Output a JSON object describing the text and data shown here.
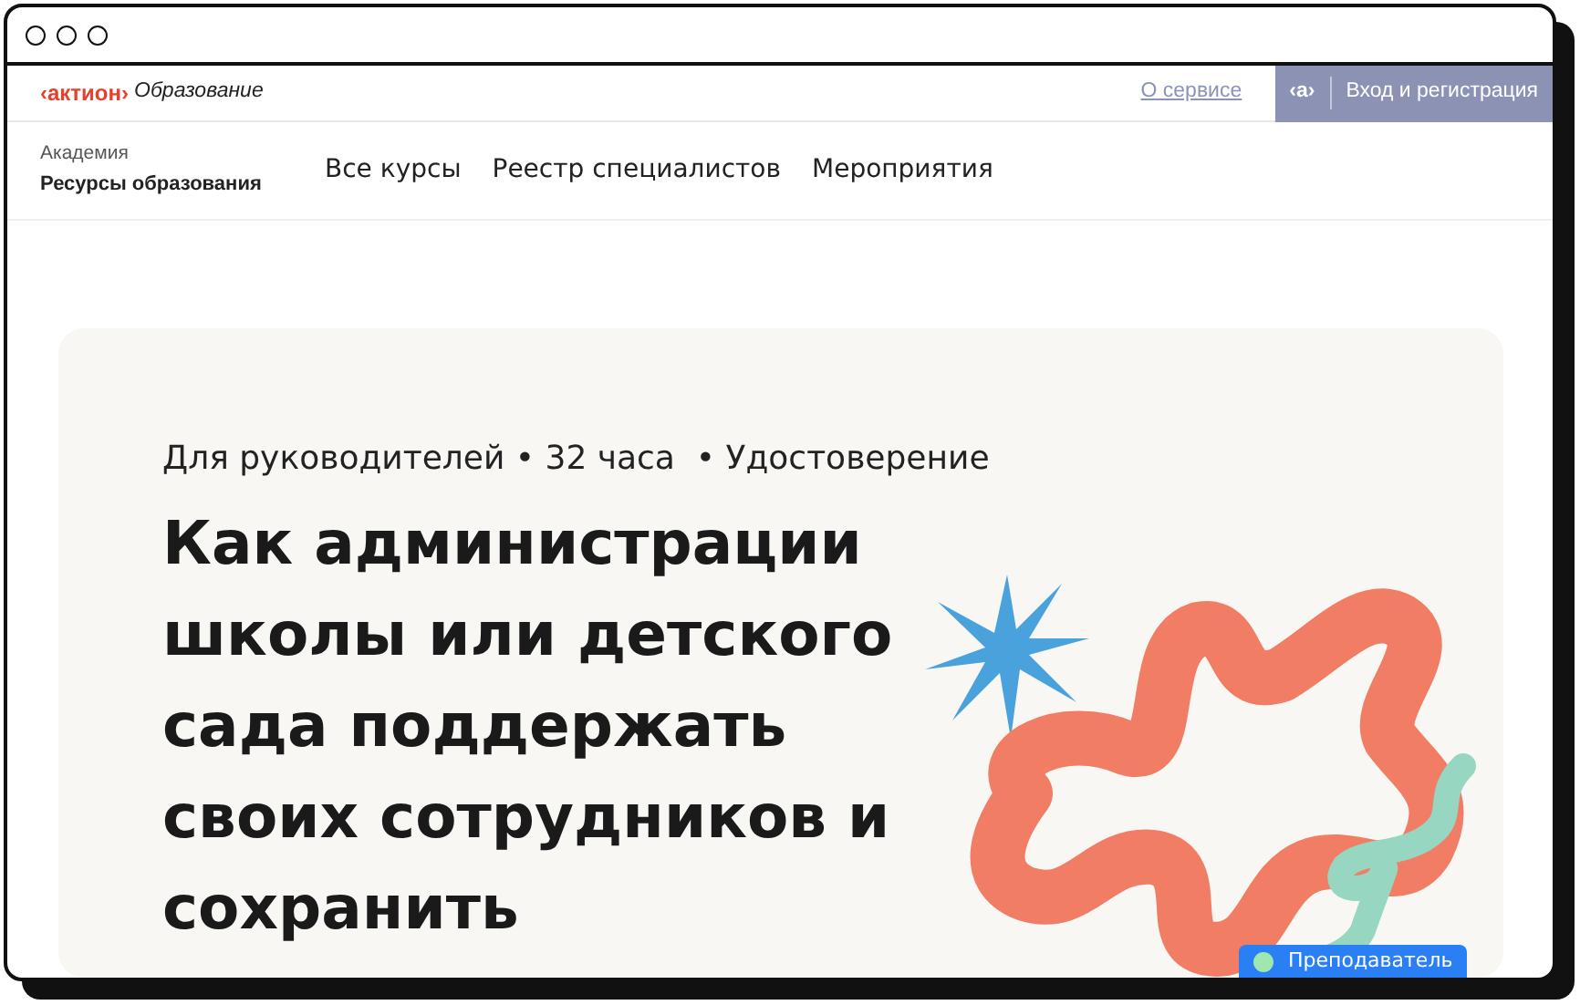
{
  "logo": {
    "brand": "‹актион›",
    "product": "Образование"
  },
  "top_links": {
    "about": "О сервисе",
    "login_mark": "‹а›",
    "login": "Вход и регистрация"
  },
  "academy": {
    "label": "Академия",
    "name": "Ресурсы образования"
  },
  "nav": [
    {
      "label": "Все курсы"
    },
    {
      "label": "Реестр специалистов"
    },
    {
      "label": "Мероприятия"
    }
  ],
  "hero": {
    "meta": "Для руководителей • 32 часа  • Удостоверение",
    "title": "Как администрации школы или детского сада поддержать своих сотрудников и сохранить"
  },
  "float_button": {
    "label": "Преподаватель"
  }
}
